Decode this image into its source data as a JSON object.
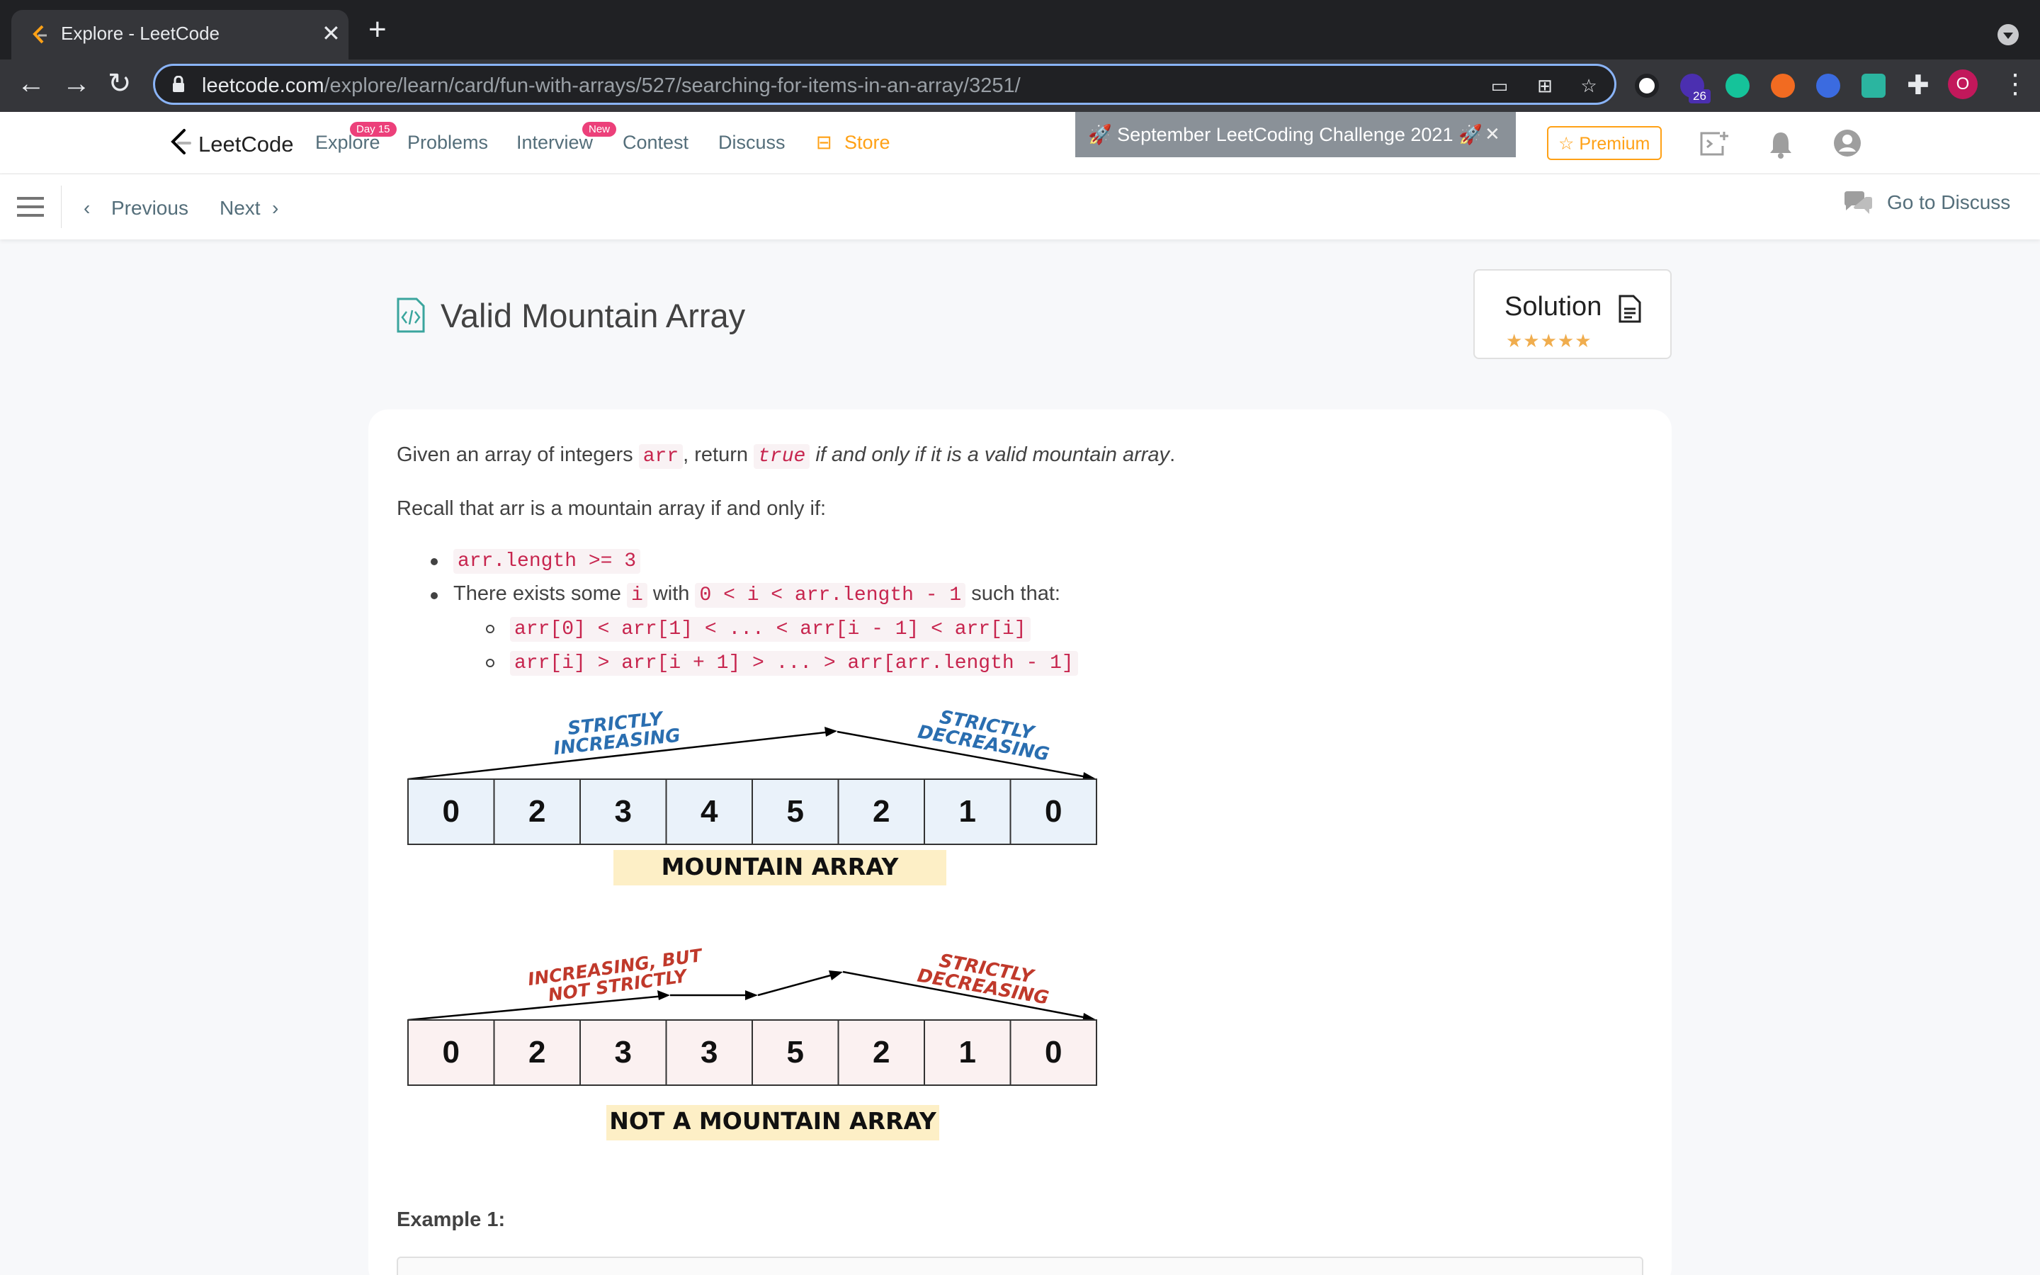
{
  "browser": {
    "tab_title": "Explore - LeetCode",
    "url_domain": "leetcode.com",
    "url_path": "/explore/learn/card/fun-with-arrays/527/searching-for-items-in-an-array/3251/",
    "extension_badge": "26",
    "profile_initial": "O"
  },
  "header": {
    "logo_text": "LeetCode",
    "nav": [
      {
        "label": "Explore",
        "badge": "Day 15"
      },
      {
        "label": "Problems"
      },
      {
        "label": "Interview",
        "badge": "New"
      },
      {
        "label": "Contest"
      },
      {
        "label": "Discuss"
      },
      {
        "label": "Store"
      }
    ],
    "banner": "🚀 September LeetCoding Challenge 2021 🚀",
    "premium": "Premium"
  },
  "subnav": {
    "previous": "Previous",
    "next": "Next",
    "discuss": "Go to Discuss"
  },
  "problem": {
    "title": "Valid Mountain Array",
    "solution_label": "Solution",
    "rating_stars": 5,
    "intro": {
      "before_arr": "Given an array of integers ",
      "arr": "arr",
      "mid": ", return ",
      "true": "true",
      "italic": "if and only if it is a valid mountain array",
      "end": "."
    },
    "recall": "Recall that arr is a mountain array if and only if:",
    "cond1": "arr.length >= 3",
    "cond2": {
      "a": "There exists some ",
      "i": "i",
      "b": " with ",
      "range": "0 < i < arr.length - 1",
      "c": " such that:"
    },
    "sub1": "arr[0] < arr[1] < ... < arr[i - 1] < arr[i]",
    "sub2": "arr[i] > arr[i + 1] > ... > arr[arr.length - 1]",
    "example_heading": "Example 1:"
  },
  "figures": {
    "mountain": {
      "values": [
        "0",
        "2",
        "3",
        "4",
        "5",
        "2",
        "1",
        "0"
      ],
      "left_label": [
        "STRICTLY",
        "INCREASING"
      ],
      "right_label": [
        "STRICTLY",
        "DECREASING"
      ],
      "caption": "MOUNTAIN ARRAY"
    },
    "not_mountain": {
      "values": [
        "0",
        "2",
        "3",
        "3",
        "5",
        "2",
        "1",
        "0"
      ],
      "left_label": [
        "INCREASING, BUT",
        "NOT STRICTLY"
      ],
      "right_label": [
        "STRICTLY",
        "DECREASING"
      ],
      "caption": "NOT A MOUNTAIN ARRAY"
    }
  },
  "colors": {
    "accent": "#ffa116",
    "badge": "#ec407a",
    "code_text": "#c7254e",
    "blue_label": "#2a6eb0",
    "red_label": "#c0392b",
    "caption_bg": "#fdefc6"
  }
}
